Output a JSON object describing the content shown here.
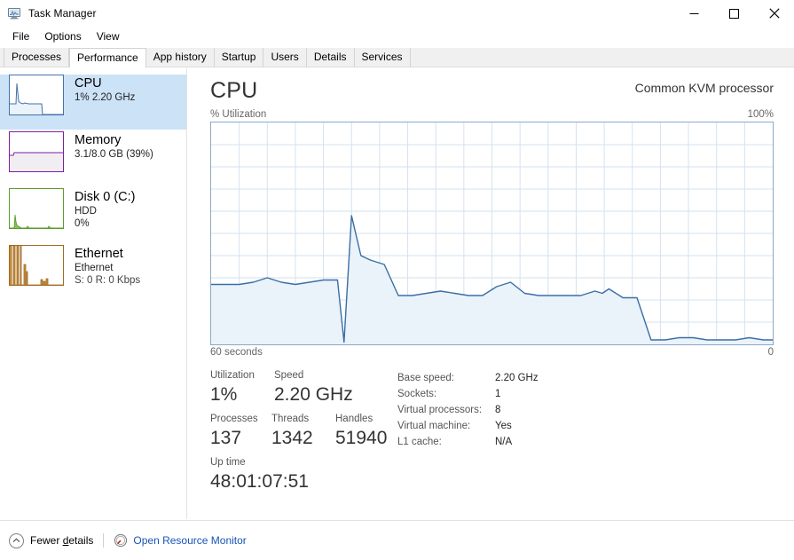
{
  "window": {
    "title": "Task Manager",
    "icon": "task-manager-icon",
    "controls": {
      "minimize": "minimize-icon",
      "maximize": "maximize-icon",
      "close": "close-icon"
    }
  },
  "menu": {
    "items": [
      "File",
      "Options",
      "View"
    ]
  },
  "tabs": {
    "items": [
      "Processes",
      "Performance",
      "App history",
      "Startup",
      "Users",
      "Details",
      "Services"
    ],
    "active": "Performance"
  },
  "sidebar": {
    "items": [
      {
        "name": "CPU",
        "lines": [
          "1%  2.20 GHz"
        ],
        "color": "#4472a8",
        "fill": "#eaf2fa",
        "selected": true
      },
      {
        "name": "Memory",
        "lines": [
          "3.1/8.0 GB (39%)"
        ],
        "color": "#7d1e9e",
        "fill": "#f0eef2",
        "selected": false
      },
      {
        "name": "Disk 0 (C:)",
        "lines": [
          "HDD",
          "0%"
        ],
        "color": "#5a9b2e",
        "fill": "#eef5e8",
        "selected": false
      },
      {
        "name": "Ethernet",
        "lines": [
          "Ethernet",
          "S: 0 R: 0 Kbps"
        ],
        "color": "#a06a23",
        "fill": "#f7f0e6",
        "selected": false
      }
    ]
  },
  "main": {
    "title": "CPU",
    "subtitle": "Common KVM processor",
    "axis_top_left": "% Utilization",
    "axis_top_right": "100%",
    "axis_bottom_left": "60 seconds",
    "axis_bottom_right": "0"
  },
  "stats": {
    "left": [
      [
        {
          "label": "Utilization",
          "value": "1%"
        },
        {
          "label": "Speed",
          "value": "2.20 GHz"
        }
      ],
      [
        {
          "label": "Processes",
          "value": "137"
        },
        {
          "label": "Threads",
          "value": "1342"
        },
        {
          "label": "Handles",
          "value": "51940"
        }
      ],
      [
        {
          "label": "Up time",
          "value": "48:01:07:51"
        }
      ]
    ],
    "right": [
      {
        "key": "Base speed:",
        "value": "2.20 GHz"
      },
      {
        "key": "Sockets:",
        "value": "1"
      },
      {
        "key": "Virtual processors:",
        "value": "8"
      },
      {
        "key": "Virtual machine:",
        "value": "Yes"
      },
      {
        "key": "L1 cache:",
        "value": "N/A"
      }
    ]
  },
  "footer": {
    "fewer_details_pre": "Fewer ",
    "fewer_details_accel": "d",
    "fewer_details_post": "etails",
    "resource_monitor": "Open Resource Monitor",
    "chevron": "chevron-up-icon",
    "resource_icon": "resource-monitor-icon"
  },
  "chart_data": {
    "type": "area",
    "title": "CPU % Utilization",
    "xlabel": "60 seconds",
    "ylabel": "% Utilization",
    "ylim": [
      0,
      100
    ],
    "xlim": [
      0,
      60
    ],
    "grid": true,
    "grid_cols": 20,
    "grid_rows": 10,
    "line_color": "#3a6ea5",
    "fill_color": "#eaf2fa",
    "x": [
      0,
      1.5,
      3,
      4.5,
      6,
      7.5,
      9,
      10.5,
      12,
      13.5,
      14.2,
      15,
      16,
      17,
      18.5,
      20,
      21.5,
      23,
      24.5,
      26,
      27.5,
      29,
      30.5,
      32,
      33.5,
      35,
      36.5,
      38,
      39.5,
      41,
      41.8,
      42.5,
      44,
      45.5,
      47,
      48.5,
      50,
      51.5,
      53,
      54.5,
      56,
      57.5,
      59,
      60
    ],
    "values": [
      27,
      27,
      27,
      28,
      30,
      28,
      27,
      28,
      29,
      29,
      1,
      58,
      40,
      38,
      36,
      22,
      22,
      23,
      24,
      23,
      22,
      22,
      26,
      28,
      23,
      22,
      22,
      22,
      22,
      24,
      23,
      25,
      21,
      21,
      2,
      2,
      3,
      3,
      2,
      2,
      2,
      3,
      2,
      2
    ]
  }
}
